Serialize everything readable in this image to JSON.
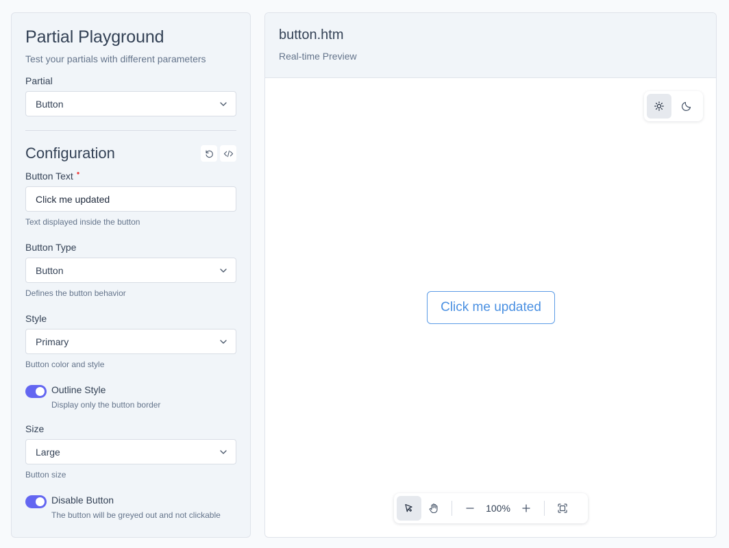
{
  "sidebar": {
    "title": "Partial Playground",
    "subtitle": "Test your partials with different parameters",
    "partial_label": "Partial",
    "partial_value": "Button",
    "config_title": "Configuration",
    "fields": {
      "button_text": {
        "label": "Button Text",
        "required_mark": "•",
        "value": "Click me updated",
        "help": "Text displayed inside the button"
      },
      "button_type": {
        "label": "Button Type",
        "value": "Button",
        "help": "Defines the button behavior"
      },
      "style": {
        "label": "Style",
        "value": "Primary",
        "help": "Button color and style"
      },
      "outline": {
        "label": "Outline Style",
        "help": "Display only the button border",
        "checked": true
      },
      "size": {
        "label": "Size",
        "value": "Large",
        "help": "Button size"
      },
      "disable": {
        "label": "Disable Button",
        "help": "The button will be greyed out and not clickable",
        "checked": true
      }
    }
  },
  "preview": {
    "title": "button.htm",
    "subtitle": "Real-time Preview",
    "button_label": "Click me updated",
    "theme": "light"
  },
  "toolbar": {
    "zoom": "100%",
    "active_tool": "select"
  },
  "colors": {
    "accent": "#6366f1",
    "preview_button": "#4a90e2",
    "required": "#ef4444"
  }
}
